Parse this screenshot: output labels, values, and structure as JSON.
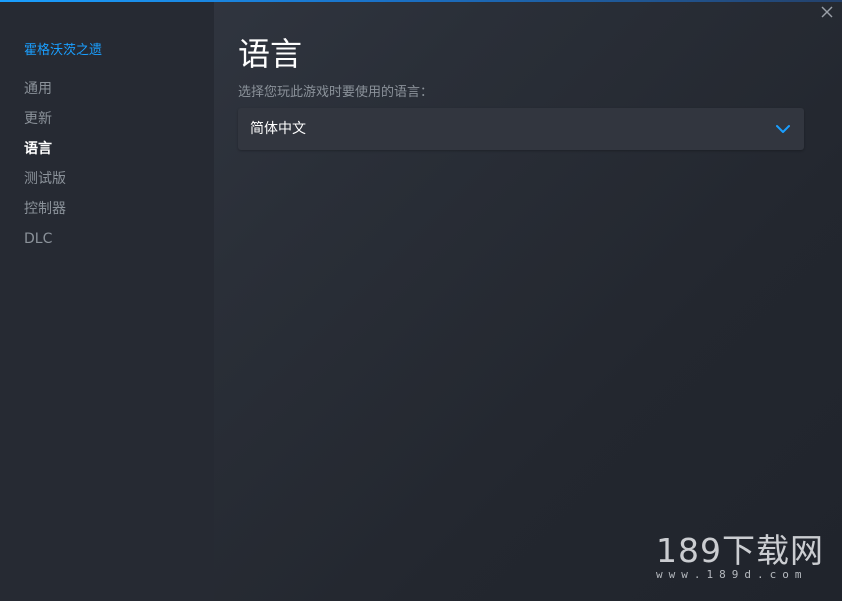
{
  "window": {
    "close_icon": "close-icon",
    "accent_color": "#1a9fff"
  },
  "sidebar": {
    "game_title": "霍格沃茨之遗",
    "items": [
      {
        "label": "通用",
        "active": false
      },
      {
        "label": "更新",
        "active": false
      },
      {
        "label": "语言",
        "active": true
      },
      {
        "label": "测试版",
        "active": false
      },
      {
        "label": "控制器",
        "active": false
      },
      {
        "label": "DLC",
        "active": false
      }
    ]
  },
  "main": {
    "title": "语言",
    "subtitle": "选择您玩此游戏时要使用的语言：",
    "language_select": {
      "selected": "简体中文",
      "icon": "chevron-down-icon"
    }
  },
  "watermark": {
    "text": "189下载网",
    "url": "www.189d.com"
  }
}
